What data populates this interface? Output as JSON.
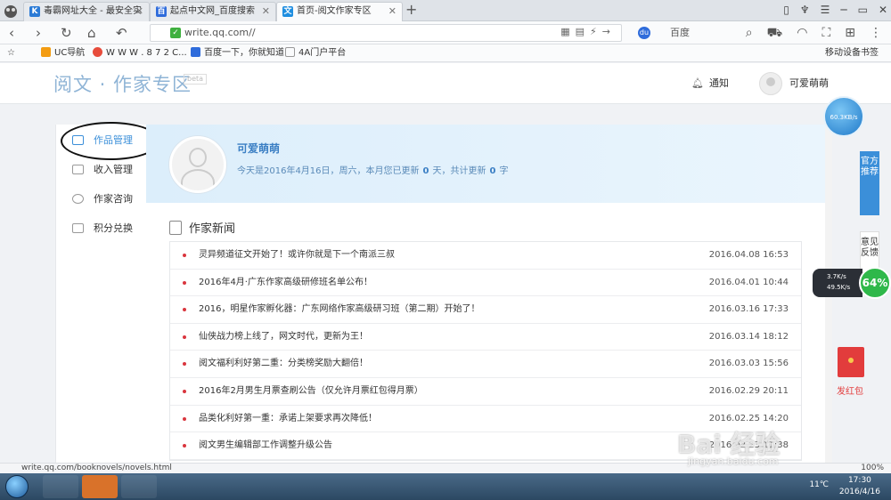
{
  "browser": {
    "tabs": [
      {
        "label": "毒霸网址大全 - 最安全实",
        "fav": "K",
        "fav_color": "#2b7bd6",
        "active": false
      },
      {
        "label": "起点中文网_百度搜索",
        "fav": "百",
        "fav_color": "#2f6cdb",
        "active": false
      },
      {
        "label": "首页-阅文作家专区",
        "fav": "文",
        "fav_color": "#1f8ee0",
        "active": true
      }
    ],
    "new_tab": "+",
    "url": "write.qq.com//",
    "search_engine": "百度",
    "bookmarks": [
      {
        "label": "UC导航",
        "color": "#f39c12"
      },
      {
        "label": "W W W . 8 7 2 C...",
        "color": "#e74c3c"
      },
      {
        "label": "百度一下，你就知道",
        "color": "#2f6cdb"
      },
      {
        "label": "4A门户平台",
        "color": "#bbbbbb"
      }
    ],
    "mobile_bookmarks": "移动设备书签",
    "status_url": "write.qq.com/booknovels/novels.html",
    "zoom": "100%"
  },
  "site": {
    "logo": "阅文 · 作家专区",
    "beta": "beta",
    "notify": "通知",
    "username": "可爱萌萌"
  },
  "sidebar": {
    "items": [
      {
        "label": "作品管理",
        "active": true
      },
      {
        "label": "收入管理",
        "active": false
      },
      {
        "label": "作家咨询",
        "active": false
      },
      {
        "label": "积分兑换",
        "active": false
      }
    ]
  },
  "profile": {
    "name": "可爱萌萌",
    "tip_prefix": "今天是2016年4月16日，周六，本月您已更新",
    "days": "0",
    "tip_mid": "天，共计更新",
    "words": "0",
    "tip_suffix": "字"
  },
  "news": {
    "title": "作家新闻",
    "items": [
      {
        "title": "灵异频道征文开始了！或许你就是下一个南派三叔",
        "date": "2016.04.08 16:53"
      },
      {
        "title": "2016年4月·广东作家高级研修班名单公布！",
        "date": "2016.04.01 10:44"
      },
      {
        "title": "2016，明星作家孵化器：广东网络作家高级研习班（第二期）开始了！",
        "date": "2016.03.16 17:33"
      },
      {
        "title": "仙侠战力榜上线了，网文时代，更新为王！",
        "date": "2016.03.14 18:12"
      },
      {
        "title": "阅文福利利好第二重：分类榜奖励大翻倍！",
        "date": "2016.03.03 15:56"
      },
      {
        "title": "2016年2月男生月票查刷公告（仅允许月票红包得月票）",
        "date": "2016.02.29 20:11"
      },
      {
        "title": "品类化利好第一重：承诺上架要求再次降低！",
        "date": "2016.02.25 14:20"
      },
      {
        "title": "阅文男生编辑部工作调整升级公告",
        "date": "2016.02.23 11:38"
      }
    ]
  },
  "widgets": {
    "speed": "60.3KB/s",
    "official_recommend": "官方推荐",
    "feedback": "意见反馈",
    "upload": "3.7K/s",
    "download": "49.5K/s",
    "percent": "64%",
    "redpack": "发红包"
  },
  "taskbar": {
    "temperature": "11℃",
    "time": "17:30",
    "date": "2016/4/16"
  },
  "watermark": {
    "main": "Bai 经验",
    "sub": "jingyan.baidu.com"
  }
}
